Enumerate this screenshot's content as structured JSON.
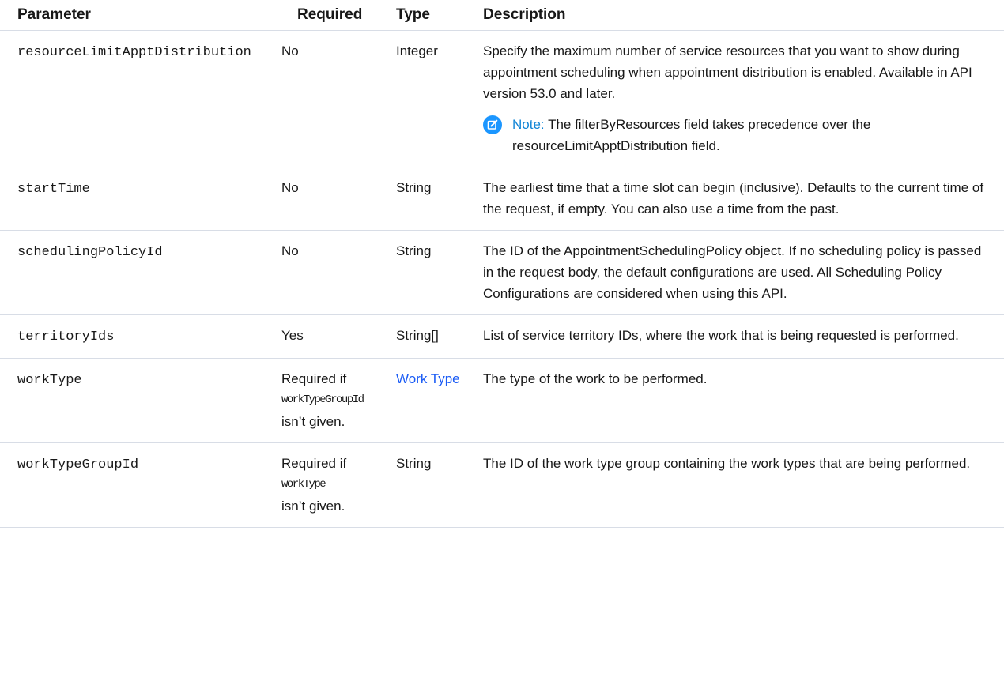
{
  "table": {
    "headers": {
      "parameter": "Parameter",
      "required": "Required",
      "type": "Type",
      "description": "Description"
    },
    "rows": [
      {
        "parameter": "resourceLimitApptDistribution",
        "required": "No",
        "type": "Integer",
        "description": "Specify the maximum number of service resources that you want to show during appointment scheduling when appointment distribution is enabled. Available in API version 53.0 and later.",
        "note_label": "Note:",
        "note_text": "The filterByResources field takes precedence over the resourceLimitApptDistribution field."
      },
      {
        "parameter": "startTime",
        "required": "No",
        "type": "String",
        "description": "The earliest time that a time slot can begin (inclusive). Defaults to the current time of the request, if empty. You can also use a time from the past."
      },
      {
        "parameter": "schedulingPolicyId",
        "required": "No",
        "type": "String",
        "description": "The ID of the AppointmentSchedulingPolicy object. If no scheduling policy is passed in the request body, the default configurations are used. All Scheduling Policy Configurations are considered when using this API."
      },
      {
        "parameter": "territoryIds",
        "required": "Yes",
        "type": "String[]",
        "description": "List of service territory IDs, where the work that is being requested is performed."
      },
      {
        "parameter": "workType",
        "required_prefix": "Required if",
        "required_code": "workTypeGroupId",
        "required_suffix": "isn’t given.",
        "type": "Work Type",
        "description": "The type of the work to be performed."
      },
      {
        "parameter": "workTypeGroupId",
        "required_prefix": "Required if",
        "required_code": "workType",
        "required_suffix": "isn’t given.",
        "type": "String",
        "description": "The ID of the work type group containing the work types that are being performed."
      }
    ]
  },
  "colors": {
    "link": "#1b5cf5",
    "note_label": "#0f84d6",
    "note_icon": "#1b96ff",
    "border": "#d8dde6"
  },
  "icons": {
    "note": "edit-note-icon"
  }
}
